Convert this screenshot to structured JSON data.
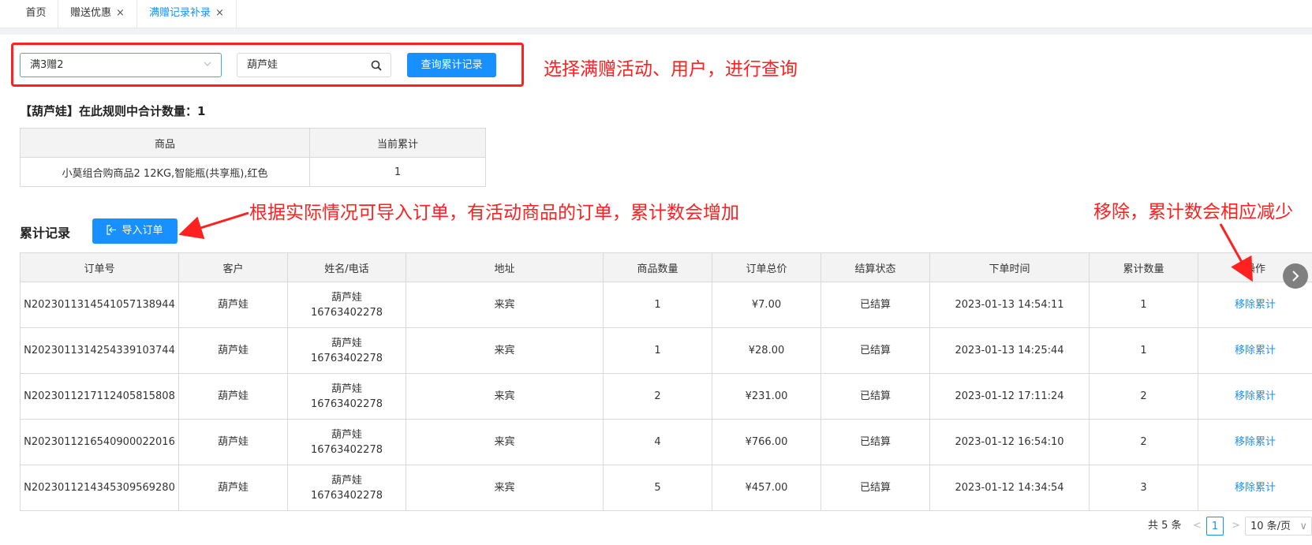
{
  "tabs": [
    {
      "label": "首页",
      "closable": false
    },
    {
      "label": "赠送优惠",
      "closable": true
    },
    {
      "label": "满赠记录补录",
      "closable": true,
      "active": true
    }
  ],
  "close_glyph": "×",
  "query": {
    "activity_value": "满3赠2",
    "user_value": "葫芦娃",
    "query_button": "查询累计记录"
  },
  "annotations": {
    "query_hint": "选择满赠活动、用户，进行查询",
    "import_hint": "根据实际情况可导入订单，有活动商品的订单，累计数会增加",
    "remove_hint": "移除，累计数会相应减少",
    "color": "#ff2020"
  },
  "summary": "【葫芦娃】在此规则中合计数量：1",
  "summary_table": {
    "headers": [
      "商品",
      "当前累计"
    ],
    "rows": [
      [
        "小莫组合购商品2 12KG,智能瓶(共享瓶),红色",
        "1"
      ]
    ]
  },
  "records": {
    "title": "累计记录",
    "import_button": "导入订单",
    "headers": [
      "订单号",
      "客户",
      "姓名/电话",
      "地址",
      "商品数量",
      "订单总价",
      "结算状态",
      "下单时间",
      "累计数量",
      "操作"
    ],
    "rows": [
      {
        "order_no": "N2023011314541057138944",
        "customer": "葫芦娃",
        "name": "葫芦娃",
        "phone": "16763402278",
        "address": "来宾",
        "qty": "1",
        "total": "¥7.00",
        "status": "已结算",
        "time": "2023-01-13 14:54:11",
        "accum": "1",
        "action": "移除累计"
      },
      {
        "order_no": "N2023011314254339103744",
        "customer": "葫芦娃",
        "name": "葫芦娃",
        "phone": "16763402278",
        "address": "来宾",
        "qty": "1",
        "total": "¥28.00",
        "status": "已结算",
        "time": "2023-01-13 14:25:44",
        "accum": "1",
        "action": "移除累计"
      },
      {
        "order_no": "N2023011217112405815808",
        "customer": "葫芦娃",
        "name": "葫芦娃",
        "phone": "16763402278",
        "address": "来宾",
        "qty": "2",
        "total": "¥231.00",
        "status": "已结算",
        "time": "2023-01-12 17:11:24",
        "accum": "2",
        "action": "移除累计"
      },
      {
        "order_no": "N2023011216540900022016",
        "customer": "葫芦娃",
        "name": "葫芦娃",
        "phone": "16763402278",
        "address": "来宾",
        "qty": "4",
        "total": "¥766.00",
        "status": "已结算",
        "time": "2023-01-12 16:54:10",
        "accum": "2",
        "action": "移除累计"
      },
      {
        "order_no": "N2023011214345309569280",
        "customer": "葫芦娃",
        "name": "葫芦娃",
        "phone": "16763402278",
        "address": "来宾",
        "qty": "5",
        "total": "¥457.00",
        "status": "已结算",
        "time": "2023-01-12 14:34:54",
        "accum": "3",
        "action": "移除累计"
      }
    ]
  },
  "pagination": {
    "total": "共 5 条",
    "current_page": "1",
    "prev": "<",
    "next": ">",
    "page_size": "10 条/页",
    "dropdown": "∨"
  },
  "colors": {
    "primary": "#1890ff",
    "price": "#ff1a1a",
    "annotation": "#ff2020"
  }
}
